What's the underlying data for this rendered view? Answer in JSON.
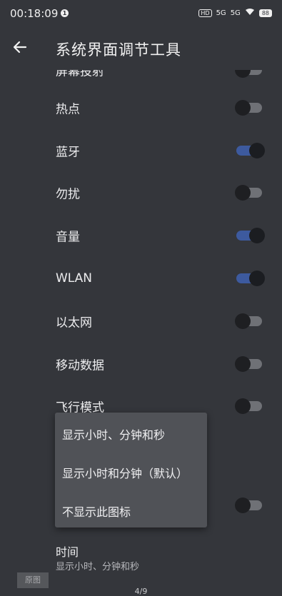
{
  "status_bar": {
    "time": "00:18:09",
    "notification_badge": "1",
    "hd_badge": "HD",
    "signal1": "5G",
    "signal2": "5G",
    "battery": "88"
  },
  "header": {
    "title": "系统界面调节工具"
  },
  "partial_row_label": "屏幕投射",
  "rows": [
    {
      "label": "热点",
      "on": false
    },
    {
      "label": "蓝牙",
      "on": true
    },
    {
      "label": "勿扰",
      "on": false
    },
    {
      "label": "音量",
      "on": true
    },
    {
      "label": "WLAN",
      "on": true
    },
    {
      "label": "以太网",
      "on": false
    },
    {
      "label": "移动数据",
      "on": false
    },
    {
      "label": "飞行模式",
      "on": false
    }
  ],
  "menu": {
    "items": [
      "显示小时、分钟和秒",
      "显示小时和分钟（默认）",
      "不显示此图标"
    ]
  },
  "time_setting": {
    "title": "时间",
    "subtitle": "显示小时、分钟和秒"
  },
  "overlay": {
    "original_button": "原图",
    "page_indicator": "4/9"
  },
  "colors": {
    "background": "#34363b",
    "toggle_on": "#3d5a9e",
    "menu_bg": "#505257"
  }
}
